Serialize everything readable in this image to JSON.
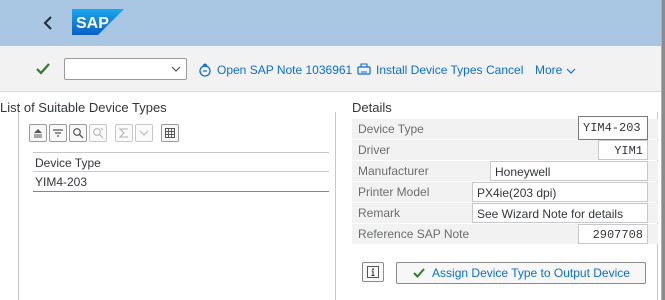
{
  "header": {
    "logo_text": "SAP",
    "back_icon": "chevron-left-icon",
    "colors": {
      "bar": "#a9c6e2",
      "logo_bg": "#0a6ed1",
      "accent": "#0a6ed1",
      "ok": "#2b7d2b"
    }
  },
  "toolbar": {
    "command_field_value": "",
    "buttons": [
      {
        "label": "Open SAP Note 1036961",
        "icon": "open-note-icon"
      },
      {
        "label": "Install Device Types",
        "icon": "install-icon"
      },
      {
        "label": "Cancel"
      },
      {
        "label": "More",
        "icon": "chevron-down-icon"
      }
    ]
  },
  "left": {
    "title": "List of Suitable Device Types",
    "list_toolbar_icons": [
      "sort-ascending-icon",
      "filter-icon",
      "search-icon",
      "search-next-icon",
      "sum-icon",
      "dropdown-icon",
      "layout-icon"
    ],
    "column_header": "Device Type",
    "rows": [
      "YIM4-203"
    ]
  },
  "details": {
    "title": "Details",
    "fields": [
      {
        "label": "Device Type",
        "value": "YIM4-203"
      },
      {
        "label": "Driver",
        "value": "YIM1"
      },
      {
        "label": "Manufacturer",
        "value": "Honeywell"
      },
      {
        "label": "Printer Model",
        "value": "PX4ie(203 dpi)"
      },
      {
        "label": "Remark",
        "value": "See Wizard Note for details"
      },
      {
        "label": "Reference SAP Note",
        "value": "2907708"
      }
    ],
    "assign_button": "Assign Device Type to Output Device",
    "info_icon": "info-icon"
  }
}
